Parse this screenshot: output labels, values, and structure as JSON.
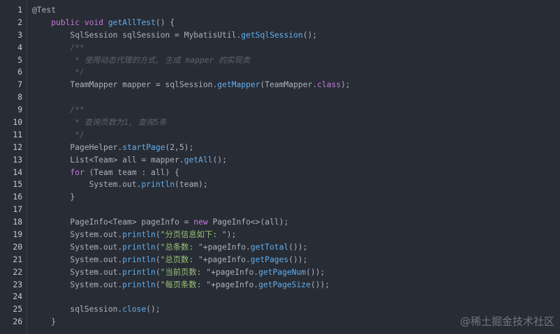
{
  "editor": {
    "lines": [
      {
        "n": "1",
        "segs": [
          [
            "ann",
            "@Test"
          ]
        ]
      },
      {
        "n": "2",
        "segs": [
          [
            "p",
            "    "
          ],
          [
            "kw",
            "public"
          ],
          [
            "p",
            " "
          ],
          [
            "kw",
            "void"
          ],
          [
            "p",
            " "
          ],
          [
            "fn",
            "getAllTest"
          ],
          [
            "p",
            "() {"
          ]
        ]
      },
      {
        "n": "3",
        "segs": [
          [
            "p",
            "        SqlSession sqlSession = MybatisUtil."
          ],
          [
            "fn",
            "getSqlSession"
          ],
          [
            "p",
            "();"
          ]
        ]
      },
      {
        "n": "4",
        "segs": [
          [
            "cm",
            "        /**"
          ]
        ]
      },
      {
        "n": "5",
        "segs": [
          [
            "cm",
            "         * 使用动态代理的方式, 生成 mapper 的实现类"
          ]
        ]
      },
      {
        "n": "6",
        "segs": [
          [
            "cm",
            "         */"
          ]
        ]
      },
      {
        "n": "7",
        "segs": [
          [
            "p",
            "        TeamMapper mapper = sqlSession."
          ],
          [
            "fn",
            "getMapper"
          ],
          [
            "p",
            "(TeamMapper."
          ],
          [
            "kw",
            "class"
          ],
          [
            "p",
            ");"
          ]
        ]
      },
      {
        "n": "8",
        "segs": [
          [
            "p",
            ""
          ]
        ]
      },
      {
        "n": "9",
        "segs": [
          [
            "cm",
            "        /**"
          ]
        ]
      },
      {
        "n": "10",
        "segs": [
          [
            "cm",
            "         * 查询页数为1, 查询5条"
          ]
        ]
      },
      {
        "n": "11",
        "segs": [
          [
            "cm",
            "         */"
          ]
        ]
      },
      {
        "n": "12",
        "segs": [
          [
            "p",
            "        PageHelper."
          ],
          [
            "fn",
            "startPage"
          ],
          [
            "p",
            "(2,5);"
          ]
        ]
      },
      {
        "n": "13",
        "segs": [
          [
            "p",
            "        List<Team> all = mapper."
          ],
          [
            "fn",
            "getAll"
          ],
          [
            "p",
            "();"
          ]
        ]
      },
      {
        "n": "14",
        "segs": [
          [
            "p",
            "        "
          ],
          [
            "kw",
            "for"
          ],
          [
            "p",
            " (Team team : all) {"
          ]
        ]
      },
      {
        "n": "15",
        "segs": [
          [
            "p",
            "            System.out."
          ],
          [
            "fn",
            "println"
          ],
          [
            "p",
            "(team);"
          ]
        ]
      },
      {
        "n": "16",
        "segs": [
          [
            "p",
            "        }"
          ]
        ]
      },
      {
        "n": "17",
        "segs": [
          [
            "p",
            ""
          ]
        ]
      },
      {
        "n": "18",
        "segs": [
          [
            "p",
            "        PageInfo<Team> pageInfo = "
          ],
          [
            "kw",
            "new"
          ],
          [
            "p",
            " PageInfo<>(all);"
          ]
        ]
      },
      {
        "n": "19",
        "segs": [
          [
            "p",
            "        System.out."
          ],
          [
            "fn",
            "println"
          ],
          [
            "p",
            "("
          ],
          [
            "str",
            "\"分页信息如下: \""
          ],
          [
            "p",
            ");"
          ]
        ]
      },
      {
        "n": "20",
        "segs": [
          [
            "p",
            "        System.out."
          ],
          [
            "fn",
            "println"
          ],
          [
            "p",
            "("
          ],
          [
            "str",
            "\"总条数: \""
          ],
          [
            "p",
            "+pageInfo."
          ],
          [
            "fn",
            "getTotal"
          ],
          [
            "p",
            "());"
          ]
        ]
      },
      {
        "n": "21",
        "segs": [
          [
            "p",
            "        System.out."
          ],
          [
            "fn",
            "println"
          ],
          [
            "p",
            "("
          ],
          [
            "str",
            "\"总页数: \""
          ],
          [
            "p",
            "+pageInfo."
          ],
          [
            "fn",
            "getPages"
          ],
          [
            "p",
            "());"
          ]
        ]
      },
      {
        "n": "22",
        "segs": [
          [
            "p",
            "        System.out."
          ],
          [
            "fn",
            "println"
          ],
          [
            "p",
            "("
          ],
          [
            "str",
            "\"当前页数: \""
          ],
          [
            "p",
            "+pageInfo."
          ],
          [
            "fn",
            "getPageNum"
          ],
          [
            "p",
            "());"
          ]
        ]
      },
      {
        "n": "23",
        "segs": [
          [
            "p",
            "        System.out."
          ],
          [
            "fn",
            "println"
          ],
          [
            "p",
            "("
          ],
          [
            "str",
            "\"每页条数: \""
          ],
          [
            "p",
            "+pageInfo."
          ],
          [
            "fn",
            "getPageSize"
          ],
          [
            "p",
            "());"
          ]
        ]
      },
      {
        "n": "24",
        "segs": [
          [
            "p",
            ""
          ]
        ]
      },
      {
        "n": "25",
        "segs": [
          [
            "p",
            "        sqlSession."
          ],
          [
            "fn",
            "close"
          ],
          [
            "p",
            "();"
          ]
        ]
      },
      {
        "n": "26",
        "segs": [
          [
            "p",
            "    }"
          ]
        ]
      }
    ]
  },
  "watermark": "@稀土掘金技术社区",
  "colors": {
    "background": "#282c34",
    "keyword": "#c678dd",
    "function": "#61afef",
    "comment": "#5c6370",
    "string": "#98c379",
    "plain": "#abb2bf"
  }
}
